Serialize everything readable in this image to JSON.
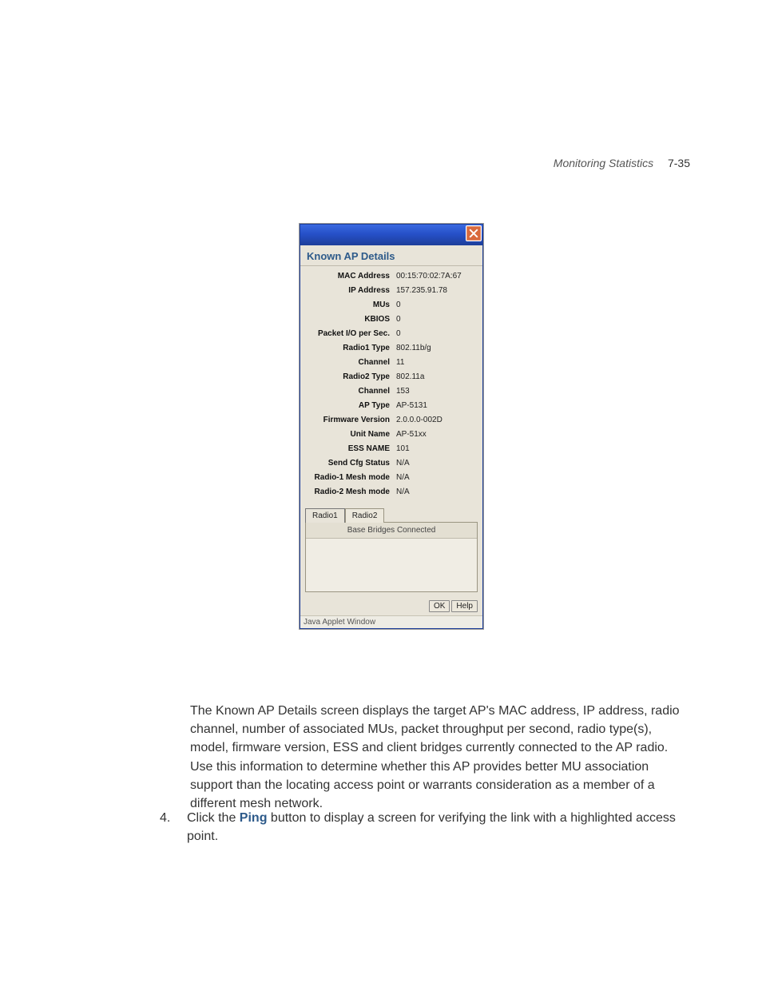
{
  "header": {
    "section": "Monitoring Statistics",
    "page_num": "7-35"
  },
  "dialog": {
    "title": "Known AP Details",
    "fields": [
      {
        "label": "MAC Address",
        "value": "00:15:70:02:7A:67"
      },
      {
        "label": "IP Address",
        "value": "157.235.91.78"
      },
      {
        "label": "MUs",
        "value": "0"
      },
      {
        "label": "KBIOS",
        "value": "0"
      },
      {
        "label": "Packet I/O per Sec.",
        "value": "0"
      },
      {
        "label": "Radio1 Type",
        "value": "802.11b/g"
      },
      {
        "label": "Channel",
        "value": "11"
      },
      {
        "label": "Radio2 Type",
        "value": "802.11a"
      },
      {
        "label": "Channel",
        "value": "153"
      },
      {
        "label": "AP Type",
        "value": "AP-5131"
      },
      {
        "label": "Firmware Version",
        "value": "2.0.0.0-002D"
      },
      {
        "label": "Unit Name",
        "value": "AP-51xx"
      },
      {
        "label": "ESS NAME",
        "value": "101"
      },
      {
        "label": "Send Cfg Status",
        "value": "N/A"
      },
      {
        "label": "Radio-1 Mesh mode",
        "value": "N/A"
      },
      {
        "label": "Radio-2 Mesh mode",
        "value": "N/A"
      }
    ],
    "tabs": {
      "tab1": "Radio1",
      "tab2": "Radio2"
    },
    "panel_header": "Base Bridges Connected",
    "buttons": {
      "ok": "OK",
      "help": "Help"
    },
    "status": "Java Applet Window"
  },
  "paragraph": "The Known AP Details screen displays the target AP's MAC address, IP address, radio channel, number of associated MUs, packet throughput per second, radio type(s), model, firmware version, ESS and client bridges currently connected to the AP radio. Use this information to determine whether this AP provides better MU association support than the locating access point or warrants consideration as a member of a different mesh network.",
  "step": {
    "num": "4.",
    "pre": "Click the ",
    "ping": "Ping",
    "post": " button to display a screen for verifying the link with a highlighted access point."
  }
}
